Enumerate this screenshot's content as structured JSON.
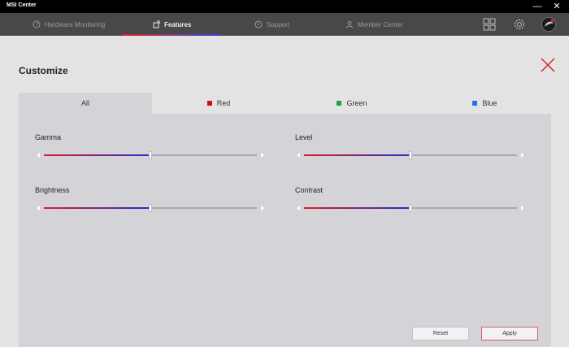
{
  "app": {
    "title": "MSI Center"
  },
  "window": {
    "minimize_glyph": "—",
    "close_glyph": "✕"
  },
  "nav": {
    "tabs": [
      {
        "label": "Hardware Monitoring",
        "icon": "gauge-icon",
        "active": false
      },
      {
        "label": "Features",
        "icon": "features-icon",
        "active": true
      },
      {
        "label": "Support",
        "icon": "support-icon",
        "active": false
      },
      {
        "label": "Member Center",
        "icon": "member-icon",
        "active": false
      }
    ],
    "right_icons": [
      "apps-grid-icon",
      "settings-gear-icon",
      "profile-avatar-icon"
    ]
  },
  "main": {
    "title": "Customize",
    "channel_tabs": [
      {
        "label": "All",
        "swatch": null,
        "active": true
      },
      {
        "label": "Red",
        "swatch": "#cc1010",
        "active": false
      },
      {
        "label": "Green",
        "swatch": "#1aa34a",
        "active": false
      },
      {
        "label": "Blue",
        "swatch": "#1e73e8",
        "active": false
      }
    ],
    "sliders": [
      {
        "label": "Gamma",
        "value": 0.5
      },
      {
        "label": "Level",
        "value": 0.5
      },
      {
        "label": "Brightness",
        "value": 0.5
      },
      {
        "label": "Contrast",
        "value": 0.5
      }
    ],
    "buttons": {
      "reset": "Reset",
      "apply": "Apply"
    }
  },
  "colors": {
    "accent_red": "#d81e2c",
    "accent_blue": "#2a2ac8",
    "nav_bg": "#484848",
    "panel_bg": "#d4d4d8"
  }
}
